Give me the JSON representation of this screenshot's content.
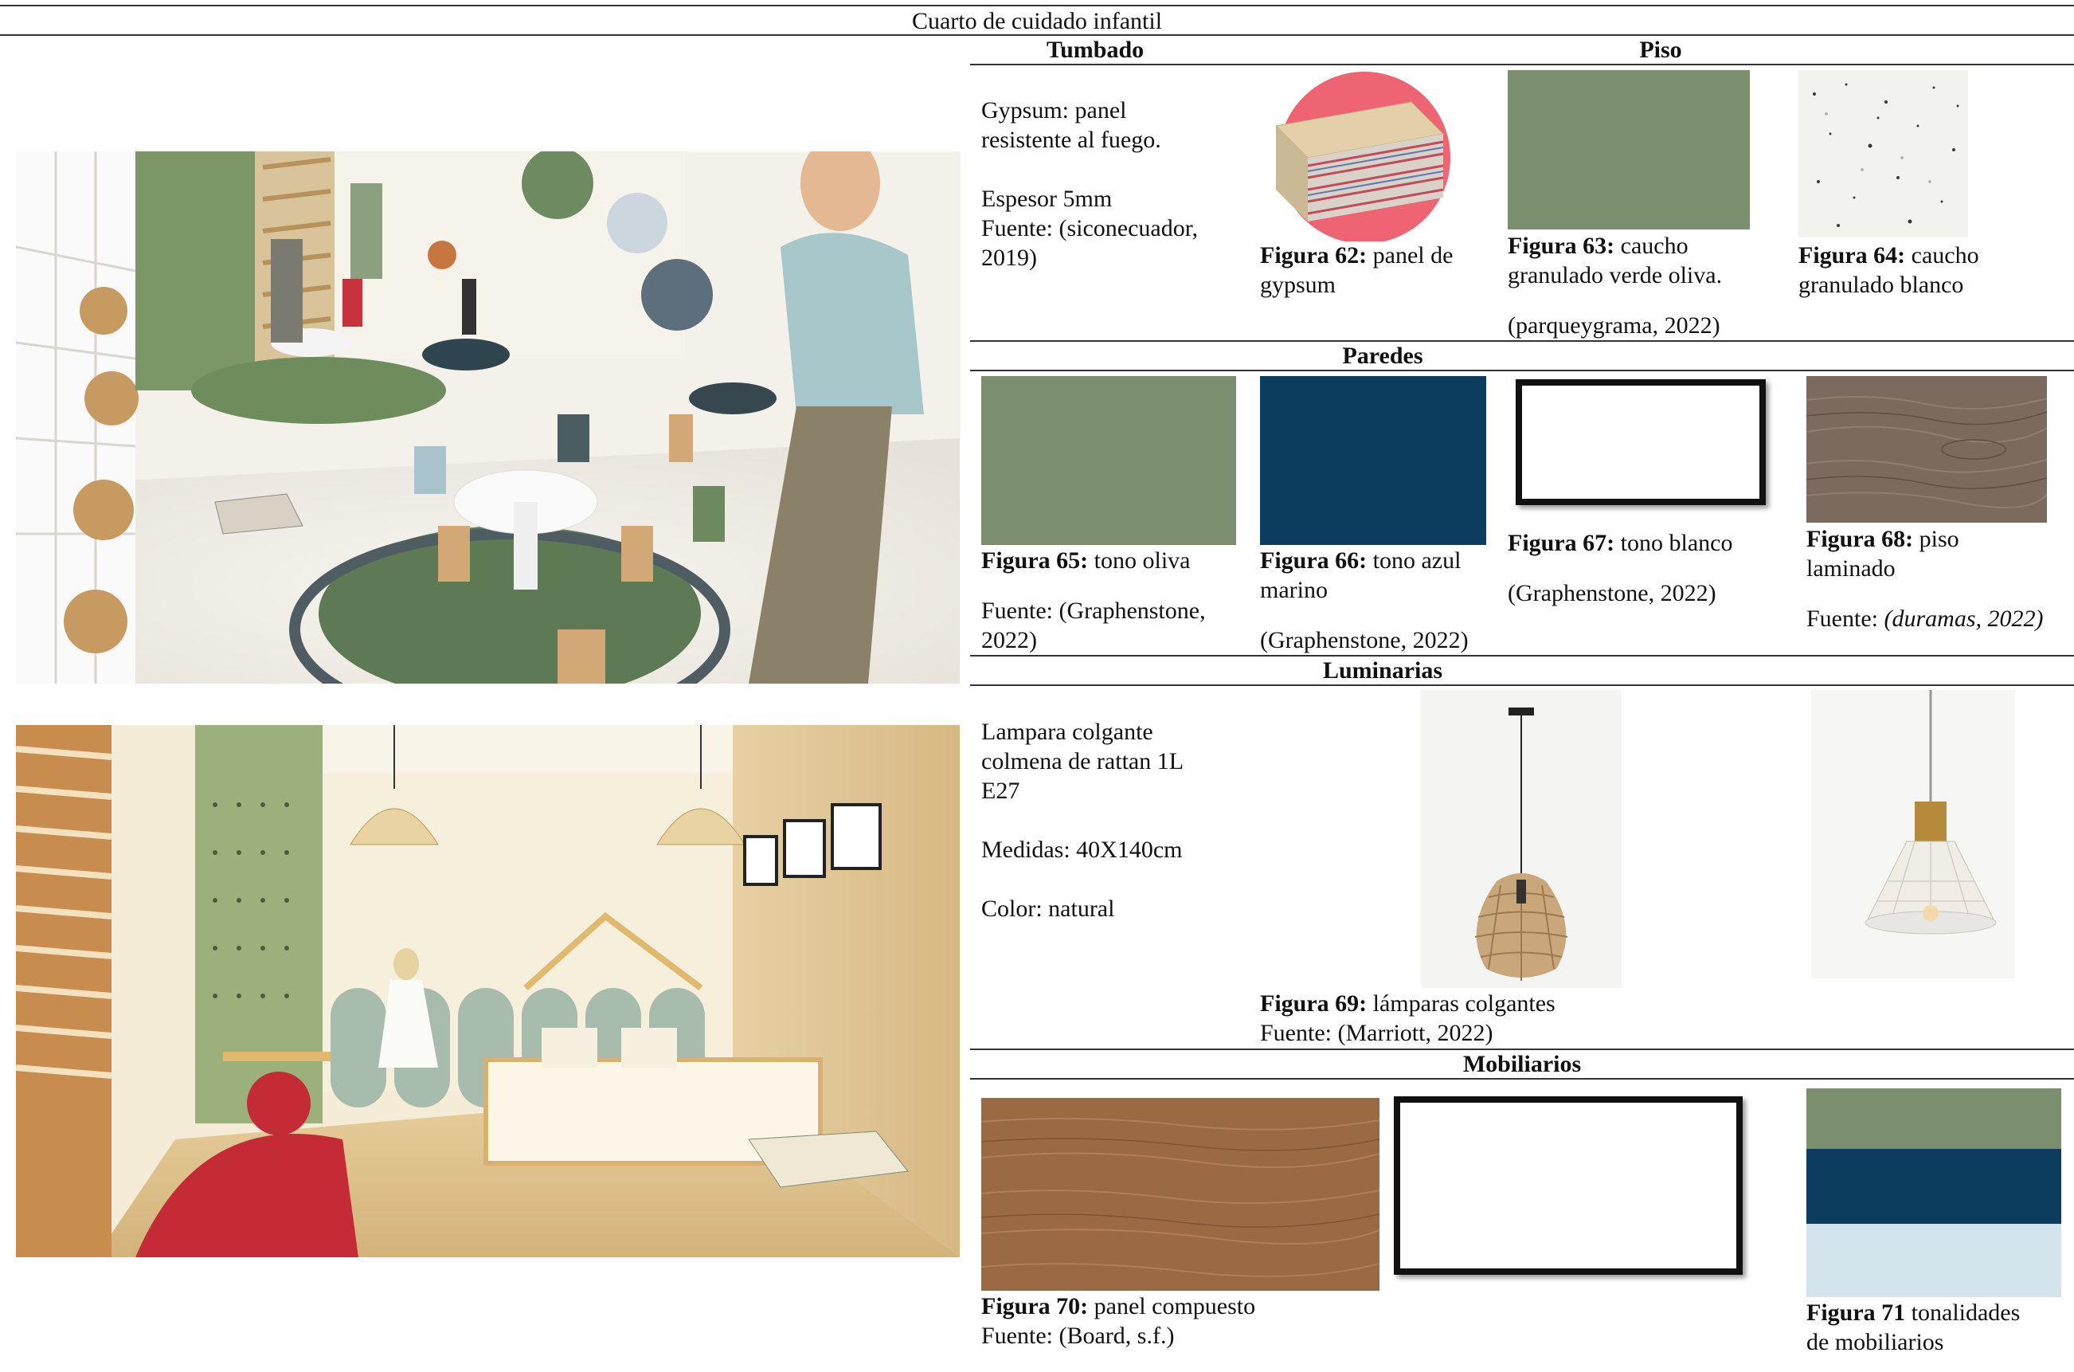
{
  "page_title": "Cuarto de cuidado infantil",
  "sections": {
    "tumbado": {
      "header": "Tumbado",
      "lines": [
        "Gypsum: panel",
        "resistente al fuego.",
        "",
        "Espesor 5mm",
        "Fuente: (siconecuador,",
        "2019)"
      ],
      "fig62": {
        "label": "Figura 62:",
        "text1": " panel de",
        "text2": "gypsum"
      }
    },
    "piso": {
      "header": "Piso",
      "fig63": {
        "label": "Figura 63:",
        "text1": " caucho",
        "text2": "granulado verde oliva.",
        "source": "(parqueygrama, 2022)"
      },
      "fig64": {
        "label": "Figura 64:",
        "text1": " caucho",
        "text2": "granulado blanco"
      }
    },
    "paredes": {
      "header": "Paredes",
      "fig65": {
        "label": "Figura 65:",
        "text1": " tono oliva",
        "source1": "Fuente: (Graphenstone,",
        "source2": "2022)"
      },
      "fig66": {
        "label": "Figura 66:",
        "text1": " tono azul",
        "text2": "marino",
        "source": "(Graphenstone, 2022)"
      },
      "fig67": {
        "label": "Figura 67:",
        "text1": " tono blanco",
        "source": "(Graphenstone, 2022)"
      },
      "fig68": {
        "label": "Figura 68:",
        "text1": " piso",
        "text2": "laminado",
        "source_prefix": "Fuente: ",
        "source_italic": "(duramas, 2022)"
      }
    },
    "luminarias": {
      "header": "Luminarias",
      "lines": [
        "Lampara colgante",
        "colmena de rattan 1L",
        "E27",
        "",
        "Medidas:  40X140cm",
        "",
        "Color: natural"
      ],
      "fig69": {
        "label": "Figura 69:",
        "text1": " lámparas colgantes",
        "source": "Fuente: (Marriott, 2022)"
      }
    },
    "mobiliarios": {
      "header": "Mobiliarios",
      "fig70": {
        "label": "Figura 70:",
        "text1": " panel compuesto",
        "source": "Fuente: (Board, s.f.)"
      },
      "fig71": {
        "label": "Figura 71",
        "text1": " tonalidades",
        "text2": "de mobiliarios"
      }
    }
  },
  "colors": {
    "olive": "#7b8f6f",
    "navy": "#0c3d5f",
    "light_blue": "#d4e4ec",
    "wood": "#9a6a45",
    "laminate": "#7b6a5d",
    "gypsum_bg": "#ef6473"
  }
}
